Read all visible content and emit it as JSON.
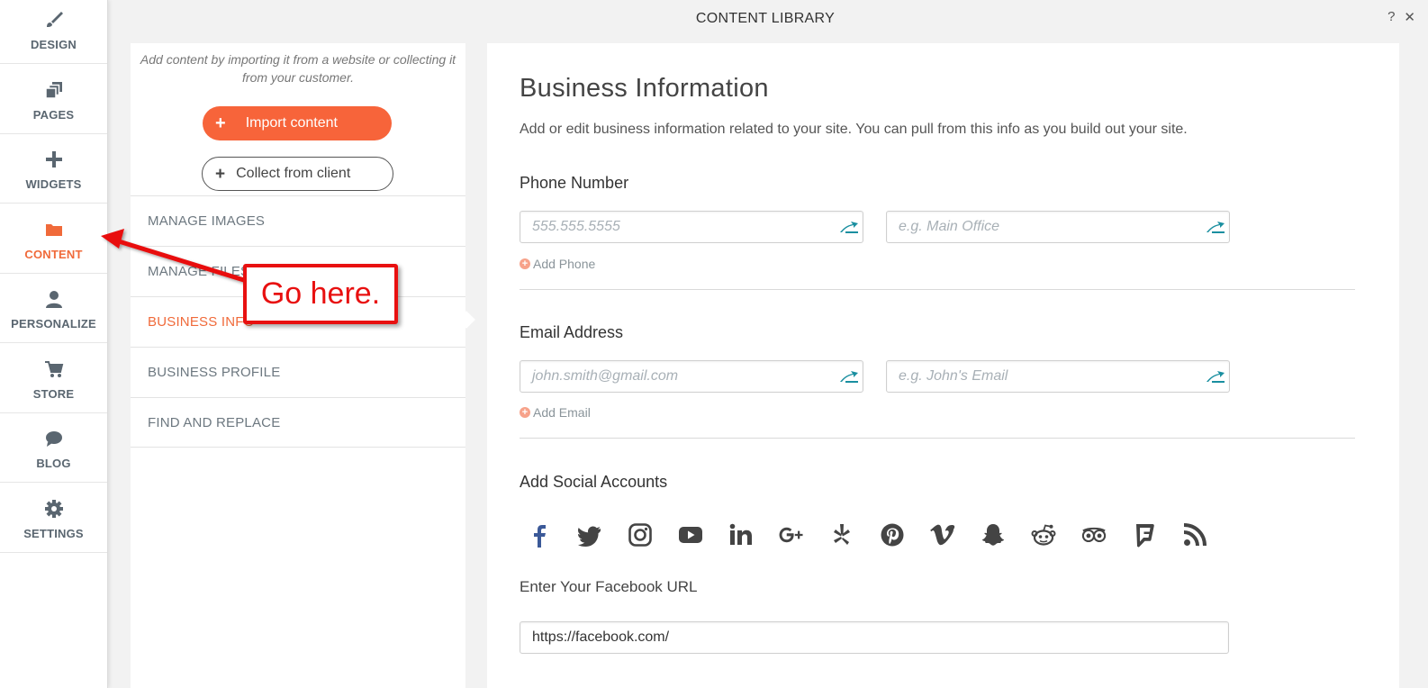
{
  "sidebar": {
    "items": [
      {
        "label": "DESIGN",
        "icon": "brush-icon"
      },
      {
        "label": "PAGES",
        "icon": "pages-icon"
      },
      {
        "label": "WIDGETS",
        "icon": "plus-icon"
      },
      {
        "label": "CONTENT",
        "icon": "folder-icon",
        "active": true
      },
      {
        "label": "PERSONALIZE",
        "icon": "person-icon"
      },
      {
        "label": "STORE",
        "icon": "cart-icon"
      },
      {
        "label": "BLOG",
        "icon": "chat-bubble-icon"
      },
      {
        "label": "SETTINGS",
        "icon": "gear-icon"
      }
    ]
  },
  "header": {
    "title": "CONTENT LIBRARY",
    "help": "?",
    "close": "✕"
  },
  "library": {
    "intro": "Add content by importing it from a website or collecting it from your customer.",
    "import_label": "Import content",
    "collect_label": "Collect from client",
    "menu": [
      {
        "label": "MANAGE IMAGES"
      },
      {
        "label": "MANAGE FILES"
      },
      {
        "label": "BUSINESS INFO"
      },
      {
        "label": "BUSINESS PROFILE"
      },
      {
        "label": "FIND AND REPLACE"
      }
    ]
  },
  "main": {
    "title": "Business Information",
    "description": "Add or edit business information related to your site. You can pull from this info as you build out your site.",
    "phone": {
      "heading": "Phone Number",
      "number_placeholder": "555.555.5555",
      "label_placeholder": "e.g. Main Office",
      "add_label": "Add Phone"
    },
    "email": {
      "heading": "Email Address",
      "address_placeholder": "john.smith@gmail.com",
      "label_placeholder": "e.g. John's Email",
      "add_label": "Add Email"
    },
    "social": {
      "heading": "Add Social Accounts",
      "icons": [
        "facebook-icon",
        "twitter-icon",
        "instagram-icon",
        "youtube-icon",
        "linkedin-icon",
        "google-plus-icon",
        "yelp-icon",
        "pinterest-icon",
        "vimeo-icon",
        "snapchat-icon",
        "reddit-icon",
        "tripadvisor-icon",
        "foursquare-icon",
        "rss-icon"
      ],
      "url_label": "Enter Your Facebook URL",
      "url_value": "https://facebook.com/"
    }
  },
  "annotation": {
    "text": "Go here.",
    "color": "#e81010"
  },
  "colors": {
    "accent": "#f06a3a",
    "button": "#f7643a",
    "facebook": "#3b5998",
    "pin": "#1a8fa0"
  }
}
